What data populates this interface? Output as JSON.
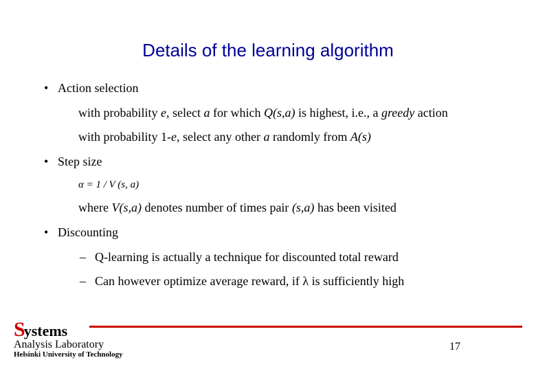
{
  "title": "Details of the learning algorithm",
  "bullets": {
    "action_selection": "Action selection",
    "action_line1_pre": "with probability ",
    "action_line1_e": "e",
    "action_line1_mid": ", select ",
    "action_line1_a": "a",
    "action_line1_mid2": " for which ",
    "action_line1_q": "Q(s,a)",
    "action_line1_mid3": " is highest, i.e., a ",
    "action_line1_greedy": "greedy",
    "action_line1_end": " action",
    "action_line2_pre": "with probability 1-",
    "action_line2_e": "e,",
    "action_line2_mid": " select any other ",
    "action_line2_a": "a",
    "action_line2_mid2": " randomly from ",
    "action_line2_as": "A(s)",
    "step_size": "Step size",
    "step_formula": "α = 1 / V (s, a)",
    "step_where_pre": "where ",
    "step_where_v": "V(s,a)",
    "step_where_mid": " denotes number of times pair ",
    "step_where_sa": "(s,a)",
    "step_where_end": " has been visited",
    "discounting": "Discounting",
    "disc_line1": "Q-learning is actually a technique for discounted total reward",
    "disc_line2_pre": "Can however optimize average reward, if ",
    "disc_line2_lambda": "λ",
    "disc_line2_end": " is sufficiently high"
  },
  "footer": {
    "s": "S",
    "ystems": "ystems",
    "line2": "Analysis Laboratory",
    "line3": "Helsinki University of Technology"
  },
  "page_number": "17"
}
